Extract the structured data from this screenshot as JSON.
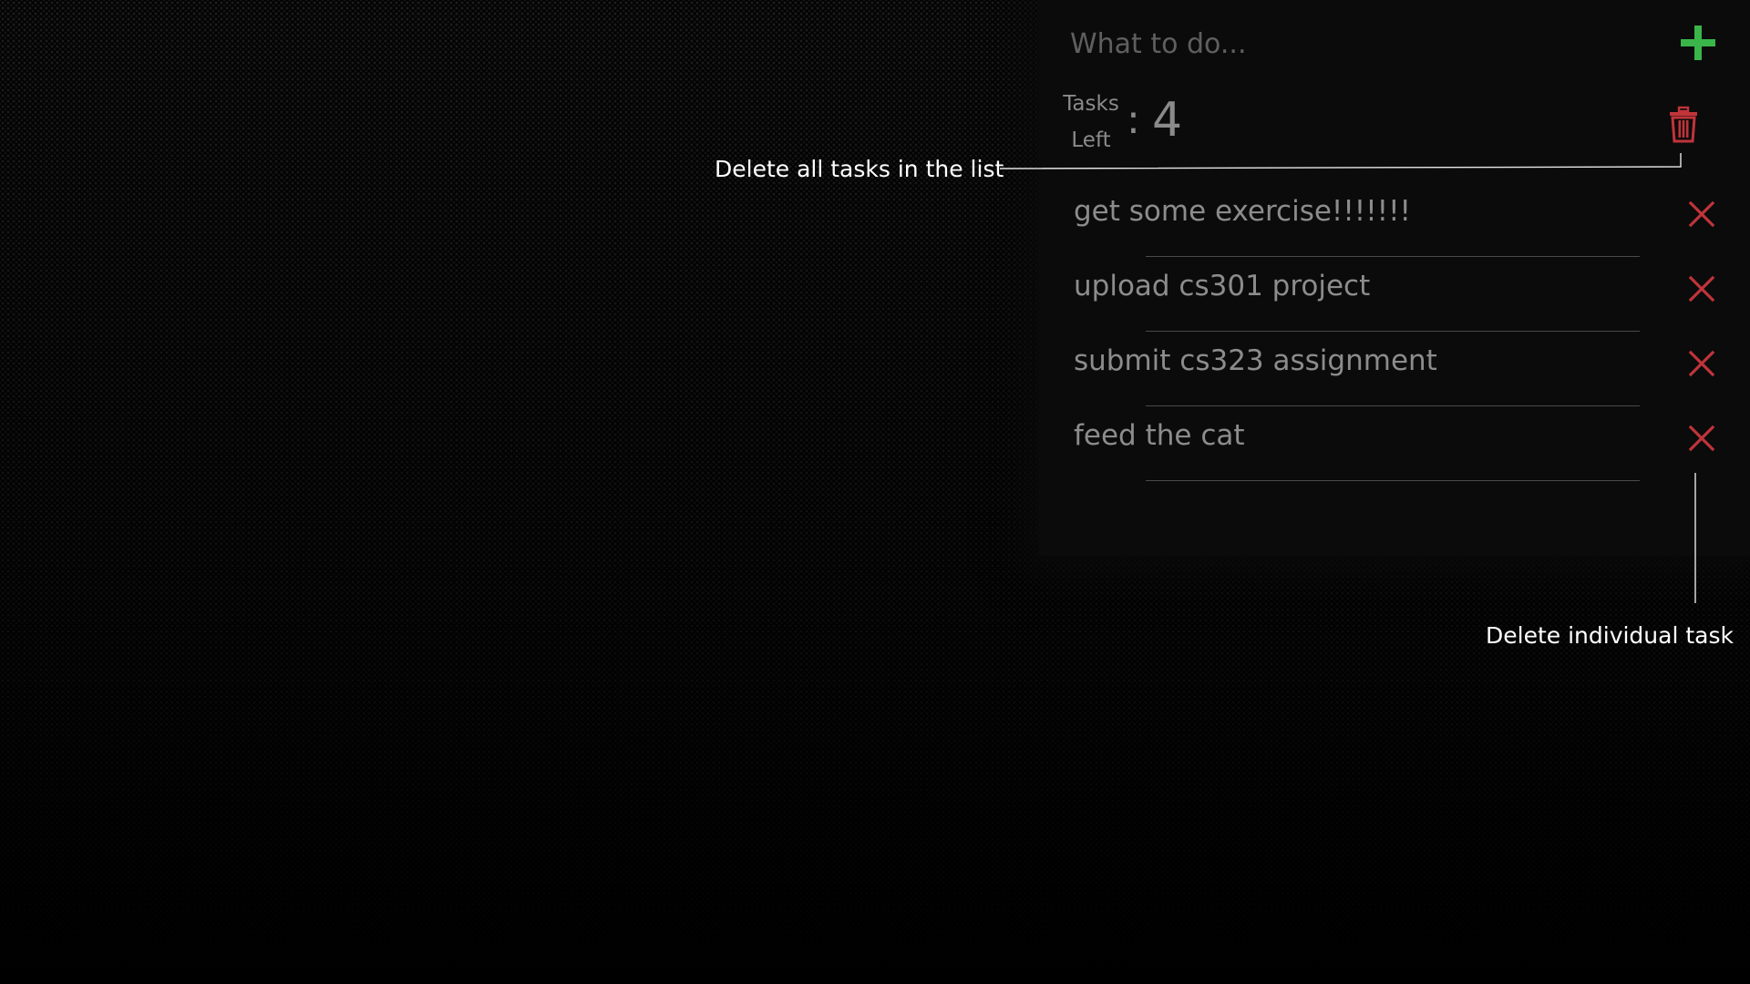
{
  "input": {
    "placeholder": "What to do...",
    "value": ""
  },
  "counter": {
    "label_line1": "Tasks",
    "label_line2": "Left",
    "separator": ":",
    "count": "4"
  },
  "tasks": [
    {
      "text": "get some exercise!!!!!!!"
    },
    {
      "text": "upload cs301 project"
    },
    {
      "text": "submit cs323 assignment"
    },
    {
      "text": "feed the cat"
    }
  ],
  "annotations": {
    "delete_all": "Delete all tasks in the list",
    "delete_individual": "Delete individual task"
  },
  "icons": {
    "add": "plus-icon",
    "delete_all": "trash-icon",
    "delete_task": "close-icon"
  },
  "colors": {
    "background": "#000000",
    "panel": "#0b0b0b",
    "add_green": "#39b54a",
    "delete_red": "#c0343a",
    "task_text": "#8c8c8c",
    "placeholder": "#5f5f5f",
    "annotation_white": "#ffffff"
  }
}
